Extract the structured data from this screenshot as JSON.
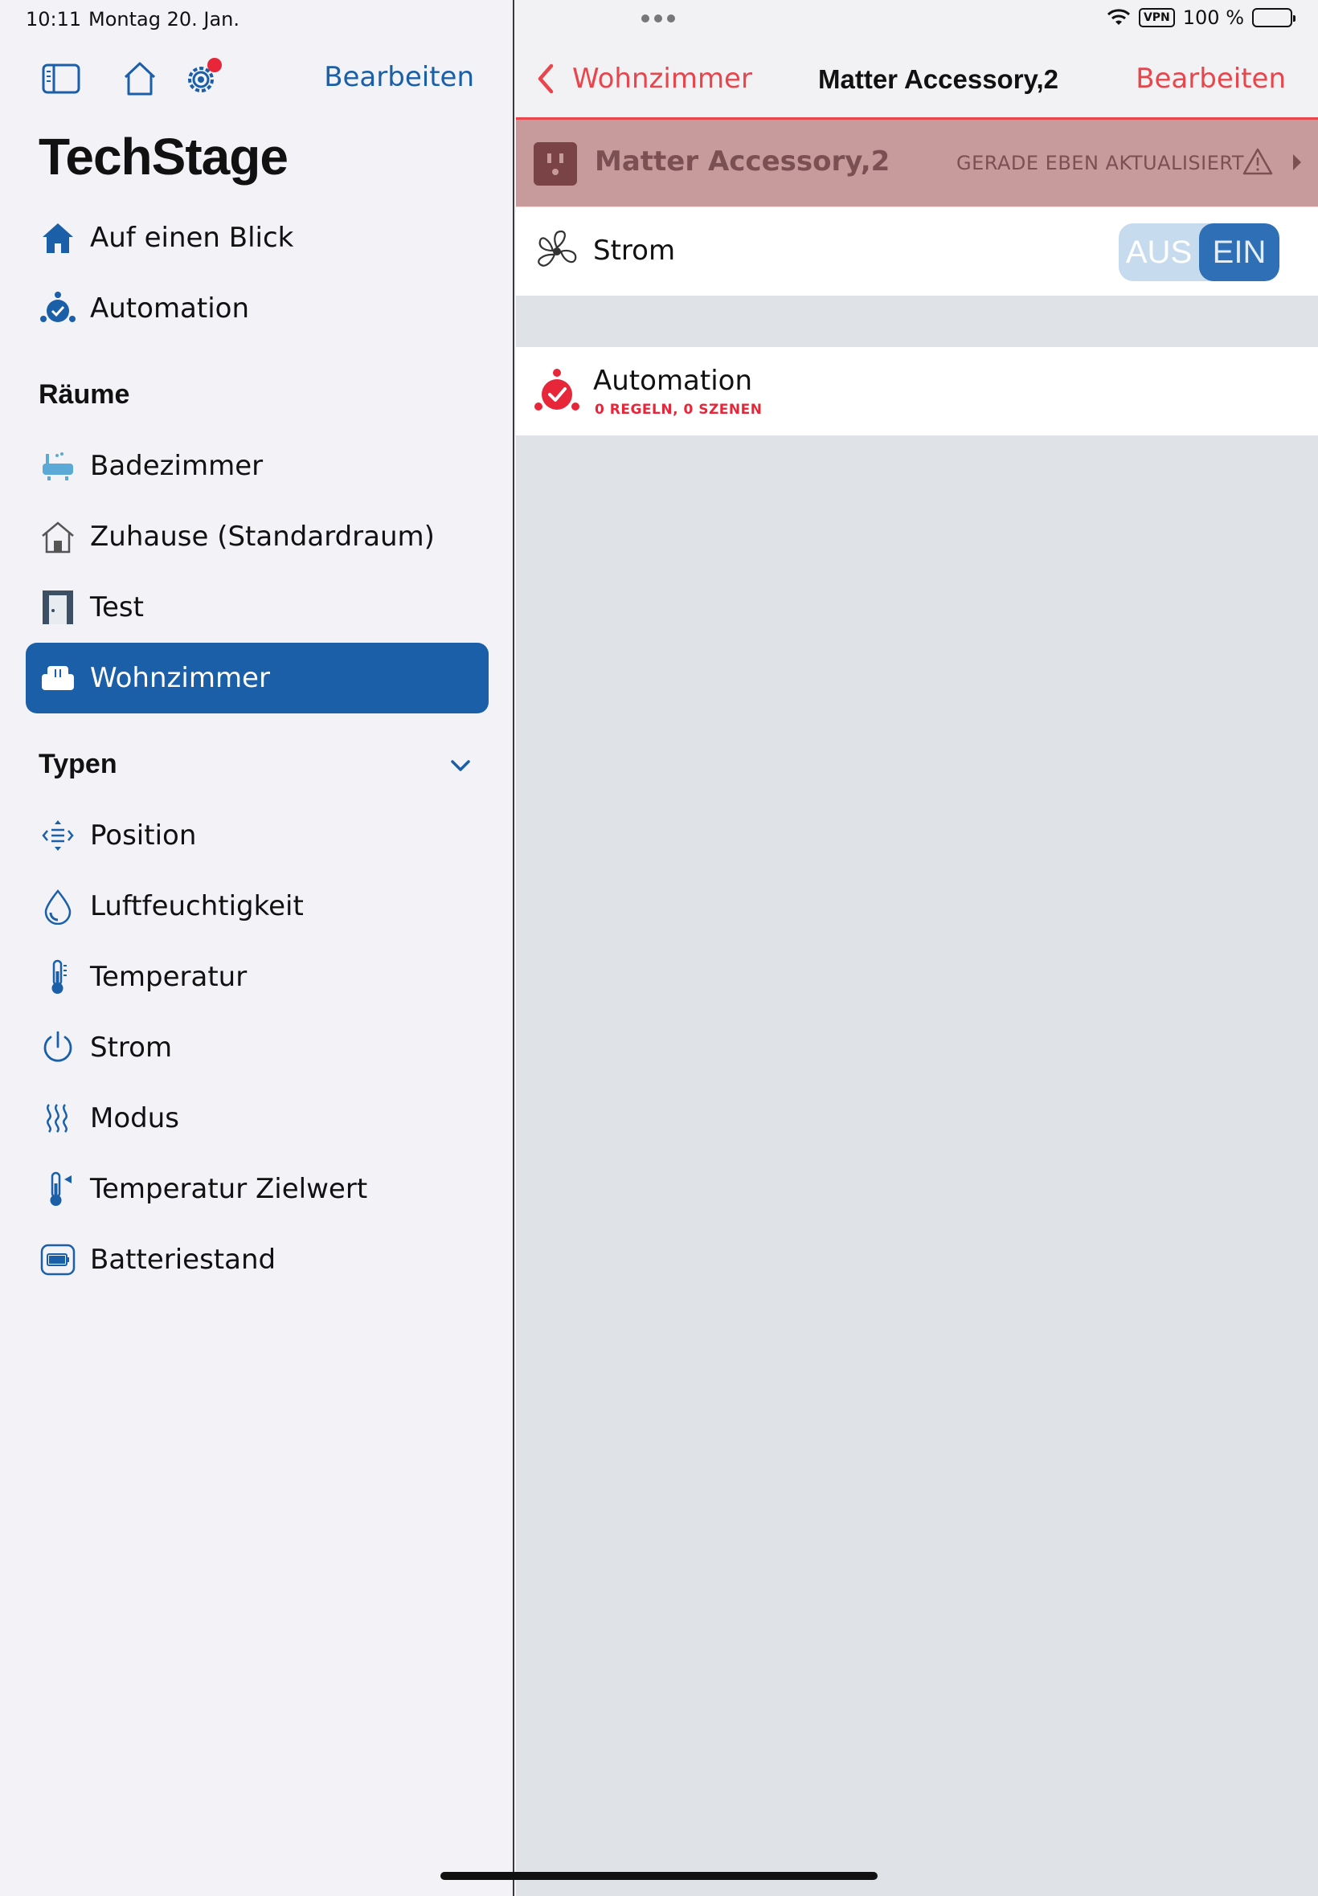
{
  "status": {
    "time": "10:11",
    "date": "Montag 20. Jan.",
    "vpn": "VPN",
    "battery": "100 %"
  },
  "sidebar": {
    "edit_label": "Bearbeiten",
    "title": "TechStage",
    "top_items": [
      {
        "label": "Auf einen Blick",
        "icon": "home-icon"
      },
      {
        "label": "Automation",
        "icon": "automation-icon"
      }
    ],
    "rooms_header": "Räume",
    "rooms": [
      {
        "label": "Badezimmer",
        "icon": "bathtub-icon"
      },
      {
        "label": "Zuhause (Standardraum)",
        "icon": "house-outline-icon"
      },
      {
        "label": "Test",
        "icon": "door-icon"
      },
      {
        "label": "Wohnzimmer",
        "icon": "sofa-icon",
        "selected": true
      }
    ],
    "types_header": "Typen",
    "types": [
      {
        "label": "Position",
        "icon": "position-icon"
      },
      {
        "label": "Luftfeuchtigkeit",
        "icon": "droplet-icon"
      },
      {
        "label": "Temperatur",
        "icon": "thermometer-icon"
      },
      {
        "label": "Strom",
        "icon": "power-icon"
      },
      {
        "label": "Modus",
        "icon": "heat-waves-icon"
      },
      {
        "label": "Temperatur Zielwert",
        "icon": "thermometer-target-icon"
      },
      {
        "label": "Batteriestand",
        "icon": "battery-icon"
      }
    ]
  },
  "detail": {
    "back_label": "Wohnzimmer",
    "title": "Matter Accessory,2",
    "edit_label": "Bearbeiten",
    "accessory_name": "Matter Accessory,2",
    "accessory_status": "GERADE EBEN AKTUALISIERT",
    "power_row": {
      "label": "Strom",
      "toggle_off": "AUS",
      "toggle_on": "EIN",
      "state": "on"
    },
    "automation_row": {
      "label": "Automation",
      "subtitle": "0 REGELN, 0 SZENEN"
    }
  },
  "colors": {
    "accent_blue": "#1a5fa8",
    "accent_red": "#e8454d",
    "accessory_banner": "#c79a9c"
  }
}
